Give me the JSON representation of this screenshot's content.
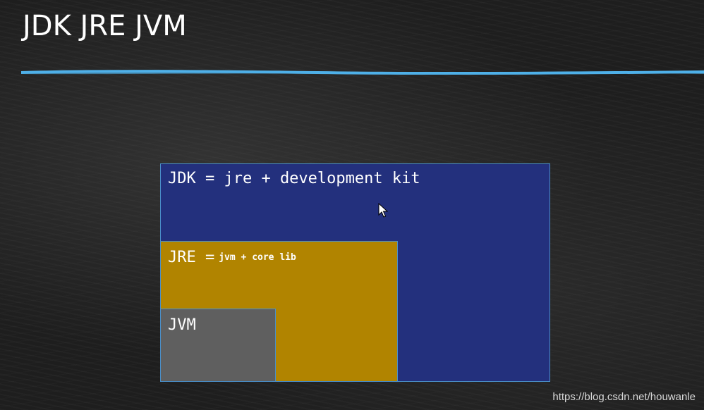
{
  "title": "JDK JRE JVM",
  "diagram": {
    "jdk": {
      "label": "JDK = jre + development kit",
      "color": "#23307d"
    },
    "jre": {
      "label_main": "JRE =",
      "label_sub": "jvm + core lib",
      "color": "#b18400"
    },
    "jvm": {
      "label": "JVM",
      "color": "#5f5f5f"
    },
    "border_color": "#4a8fc9"
  },
  "accent_line_color": "#4fb0e8",
  "cursor_icon": "mouse-pointer-icon",
  "watermark": "https://blog.csdn.net/houwanle"
}
